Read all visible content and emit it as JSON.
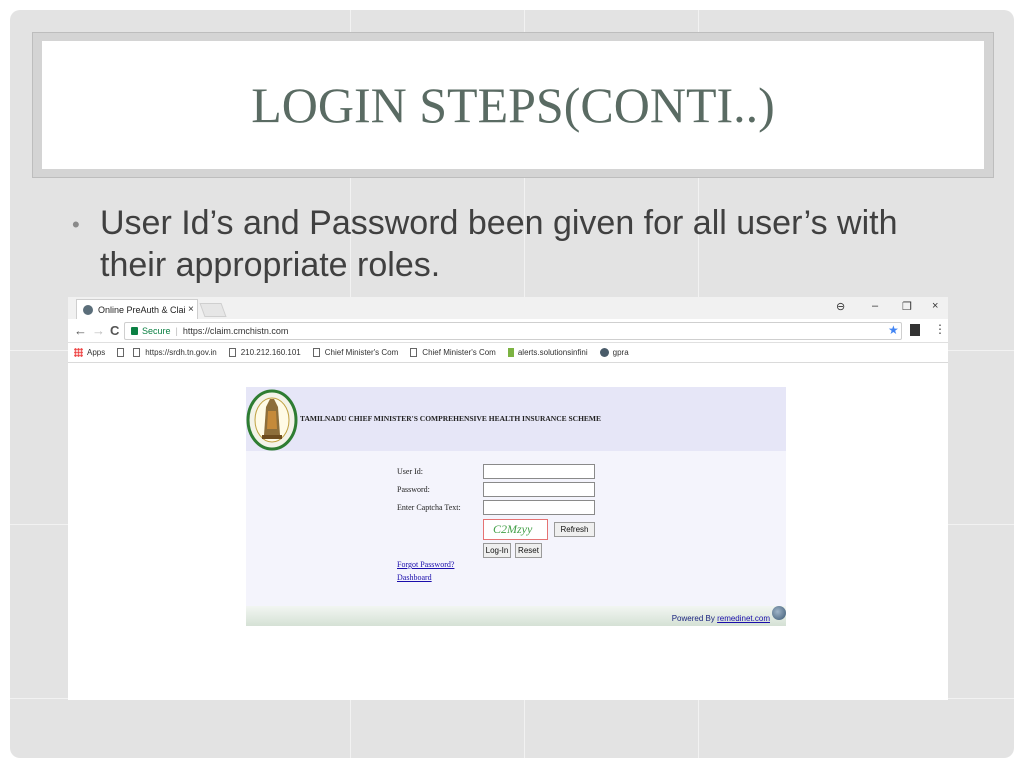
{
  "slide": {
    "title": "LOGIN STEPS(CONTI..)",
    "bullet_symbol": "•",
    "bullet": "User Id’s and Password been given for all user’s with their appropriate roles."
  },
  "browser": {
    "tab_title": "Online PreAuth & Claim",
    "tab_close": "×",
    "window_controls": {
      "account": "⊖",
      "minimize": "–",
      "restore": "❐",
      "close": "×"
    },
    "nav": {
      "back": "←",
      "forward": "→",
      "reload": "C"
    },
    "address": {
      "secure_label": "Secure",
      "separator": "|",
      "url": "https://claim.cmchistn.com"
    },
    "star": "★",
    "menu": "⋮",
    "bookmarks": [
      {
        "label": "Apps",
        "icon": "apps-icon"
      },
      {
        "label": "",
        "icon": "page-icon"
      },
      {
        "label": "https://srdh.tn.gov.in",
        "icon": "page-icon"
      },
      {
        "label": "210.212.160.101",
        "icon": "page-icon"
      },
      {
        "label": "Chief Minister's Com",
        "icon": "page-icon"
      },
      {
        "label": "Chief Minister's Com",
        "icon": "page-icon"
      },
      {
        "label": "alerts.solutionsinfini",
        "icon": "flag-icon"
      },
      {
        "label": "gpra",
        "icon": "globe-icon"
      }
    ]
  },
  "login_page": {
    "scheme_title": "TAMILNADU CHIEF MINISTER'S COMPREHENSIVE HEALTH INSURANCE SCHEME",
    "user_id_label": "User Id:",
    "password_label": "Password:",
    "captcha_label": "Enter Captcha Text:",
    "user_id_value": "",
    "password_value": "",
    "captcha_value": "",
    "captcha_text": "C2Mzyy",
    "refresh_label": "Refresh",
    "login_label": "Log-In",
    "reset_label": "Reset",
    "forgot_password": "Forgot Password?",
    "dashboard": "Dashboard",
    "powered_by": "Powered By",
    "powered_link": "remedinet.com"
  },
  "colors": {
    "slide_bg": "#e3e3e3",
    "title": "#5a6b63",
    "header_bg": "#e6e6f7",
    "captcha_text": "#43a047",
    "link": "#1a0dab"
  }
}
